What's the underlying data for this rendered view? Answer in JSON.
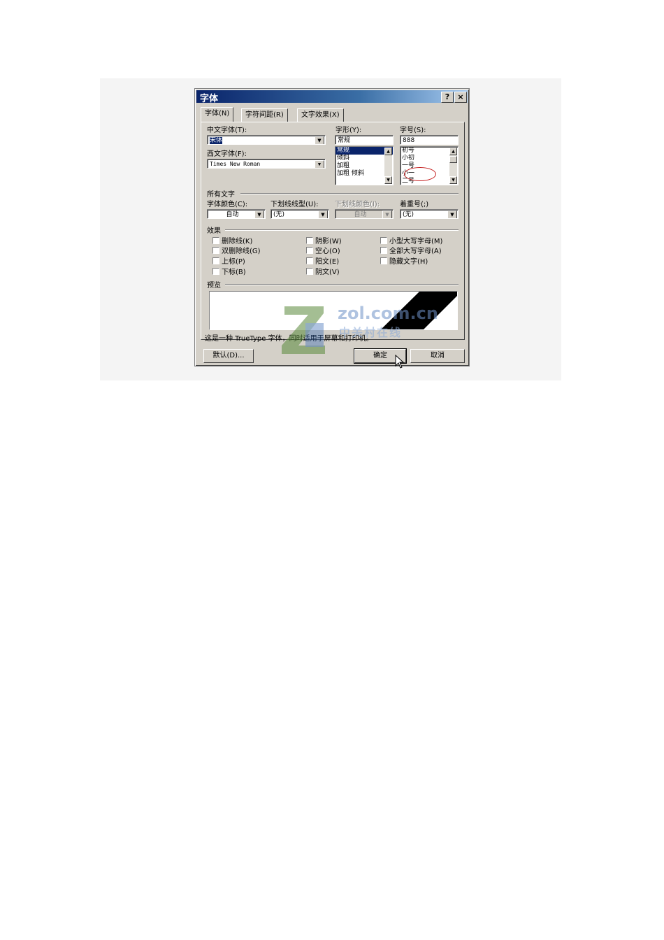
{
  "dialog": {
    "title": "字体",
    "help_button": "?",
    "close_button": "×"
  },
  "tabs": [
    {
      "label": "字体(N)",
      "active": true
    },
    {
      "label": "字符间距(R)",
      "active": false
    },
    {
      "label": "文字效果(X)",
      "active": false
    }
  ],
  "font": {
    "chinese_font_label": "中文字体(T):",
    "chinese_font_value": "宋体",
    "western_font_label": "西文字体(F):",
    "western_font_value": "Times New Roman",
    "style_label": "字形(Y):",
    "style_value": "常规",
    "style_options": [
      "常规",
      "倾斜",
      "加粗",
      "加粗 倾斜"
    ],
    "size_label": "字号(S):",
    "size_value": "888",
    "size_options": [
      "初号",
      "小初",
      "一号",
      "小一",
      "二号"
    ]
  },
  "all_text": {
    "section_label": "所有文字",
    "font_color_label": "字体颜色(C):",
    "font_color_value": "自动",
    "underline_type_label": "下划线线型(U):",
    "underline_type_value": "(无)",
    "underline_color_label": "下划线颜色(I):",
    "underline_color_value": "自动",
    "emphasis_label": "着重号(;)",
    "emphasis_value": "(无)"
  },
  "effects": {
    "section_label": "效果",
    "col1": [
      "删除线(K)",
      "双删除线(G)",
      "上标(P)",
      "下标(B)"
    ],
    "col2": [
      "阴影(W)",
      "空心(O)",
      "阳文(E)",
      "阴文(V)"
    ],
    "col3": [
      "小型大写字母(M)",
      "全部大写字母(A)",
      "隐藏文字(H)"
    ]
  },
  "preview": {
    "section_label": "预览",
    "description": "这是一种 TrueType 字体，同时适用于屏幕和打印机。"
  },
  "buttons": {
    "default": "默认(D)...",
    "ok": "确定",
    "cancel": "取消"
  },
  "watermark": {
    "site": "zol.com.cn",
    "name": "中关村在线"
  },
  "colors": {
    "title_bar": "#0a246a",
    "dialog_bg": "#d4d0c8",
    "selection": "#0a246a",
    "annotation_circle": "#c42020"
  }
}
